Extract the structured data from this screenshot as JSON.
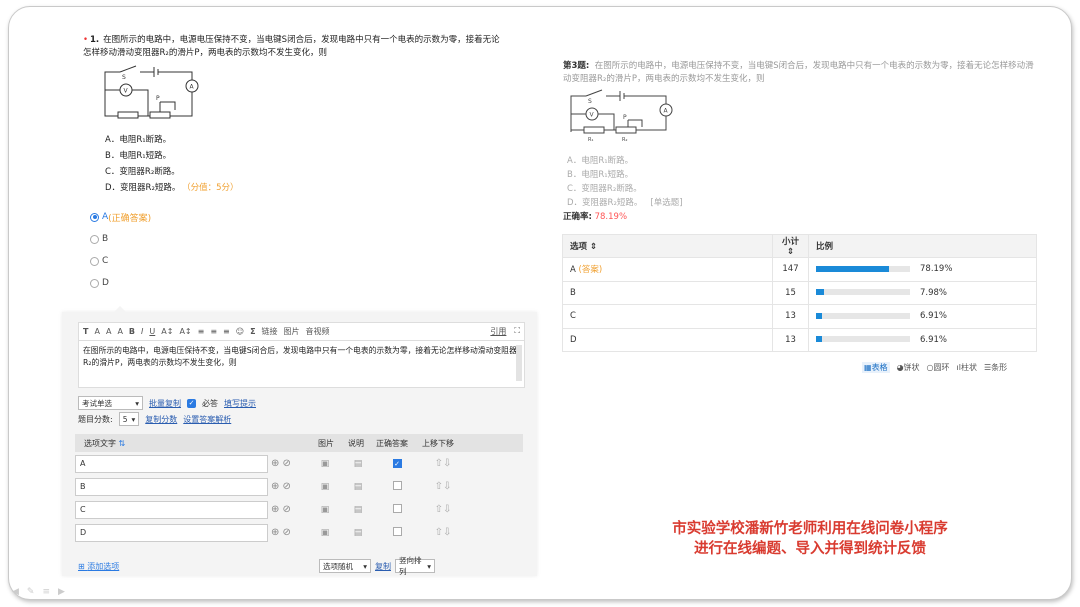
{
  "question1": {
    "required_mark": "•",
    "number": "1.",
    "text": "在图所示的电路中，电源电压保持不变，当电键S闭合后，发现电路中只有一个电表的示数为零，接着无论怎样移动滑动变阻器R₂的滑片P，两电表的示数均不发生变化，则",
    "options": [
      "A．电阻R₁断路。",
      "B．电阻R₁短路。",
      "C．变阻器R₂断路。",
      "D．变阻器R₂短路。"
    ],
    "score": "（分值：5分）",
    "radios": [
      {
        "label": "A",
        "note": "(正确答案)",
        "checked": true
      },
      {
        "label": "B",
        "note": "",
        "checked": false
      },
      {
        "label": "C",
        "note": "",
        "checked": false
      },
      {
        "label": "D",
        "note": "",
        "checked": false
      }
    ]
  },
  "circuit_labels": {
    "s": "S",
    "v": "V",
    "a": "A",
    "p": "P",
    "r1": "R₁",
    "r2": "R₂"
  },
  "editor": {
    "toolbar": [
      "T",
      "A",
      "A",
      "A",
      "B",
      "I",
      "U",
      "A↕",
      "A↕",
      "≡",
      "≡",
      "≡",
      "☺",
      "Σ",
      "链接",
      "图片",
      "音视频"
    ],
    "toolbar_right": [
      "引用",
      "⛶"
    ],
    "text": "在图所示的电路中，电源电压保持不变，当电键S闭合后，发现电路中只有一个电表的示数为零，接着无论怎样移动滑动变阻器R₂的滑片P，两电表的示数均不发生变化，则",
    "type_select": "考试单选",
    "batch_copy": "批量复制",
    "required": "必答",
    "fill_hint": "填写提示",
    "score_label": "题目分数:",
    "score_value": "5",
    "copy_score": "复制分数",
    "set_answer": "设置答案解析",
    "table_headers": {
      "option_text": "选项文字",
      "sort": "⇅",
      "image": "图片",
      "note": "说明",
      "correct": "正确答案",
      "move": "上移下移"
    },
    "rows": [
      {
        "value": "A",
        "correct": true
      },
      {
        "value": "B",
        "correct": false
      },
      {
        "value": "C",
        "correct": false
      },
      {
        "value": "D",
        "correct": false
      }
    ],
    "add_option": "添加选项",
    "random_select": "选项随机",
    "copy": "复制",
    "layout_select": "竖向排列"
  },
  "question3": {
    "label": "第3题:",
    "text": "在图所示的电路中，电源电压保持不变，当电键S闭合后，发现电路中只有一个电表的示数为零，接着无论怎样移动滑动变阻器R₂的滑片P，两电表的示数均不发生变化，则",
    "options": [
      "A．电阻R₁断路。",
      "B．电阻R₁短路。",
      "C．变阻器R₂断路。",
      "D．变阻器R₂短路。"
    ],
    "type_tag": "[单选题]",
    "rate_label": "正确率:",
    "rate_value": "78.19%"
  },
  "stats": {
    "headers": {
      "option": "选项 ⇕",
      "count": "小计 ⇕",
      "ratio": "比例"
    },
    "rows": [
      {
        "option": "A",
        "answer_tag": "(答案)",
        "count": "147",
        "percent": "78.19%",
        "fraction": 0.7819
      },
      {
        "option": "B",
        "answer_tag": "",
        "count": "15",
        "percent": "7.98%",
        "fraction": 0.0798
      },
      {
        "option": "C",
        "answer_tag": "",
        "count": "13",
        "percent": "6.91%",
        "fraction": 0.0691
      },
      {
        "option": "D",
        "answer_tag": "",
        "count": "13",
        "percent": "6.91%",
        "fraction": 0.0691
      }
    ],
    "views": [
      "表格",
      "饼状",
      "圆环",
      "柱状",
      "条形"
    ]
  },
  "caption": {
    "line1": "市实验学校潘新竹老师利用在线问卷小程序",
    "line2": "进行在线编题、导入并得到统计反馈"
  },
  "colors": {
    "accent": "#2a7ae2",
    "bar": "#1a8ad8",
    "answer": "#f0a030",
    "caption": "#d93b30"
  }
}
